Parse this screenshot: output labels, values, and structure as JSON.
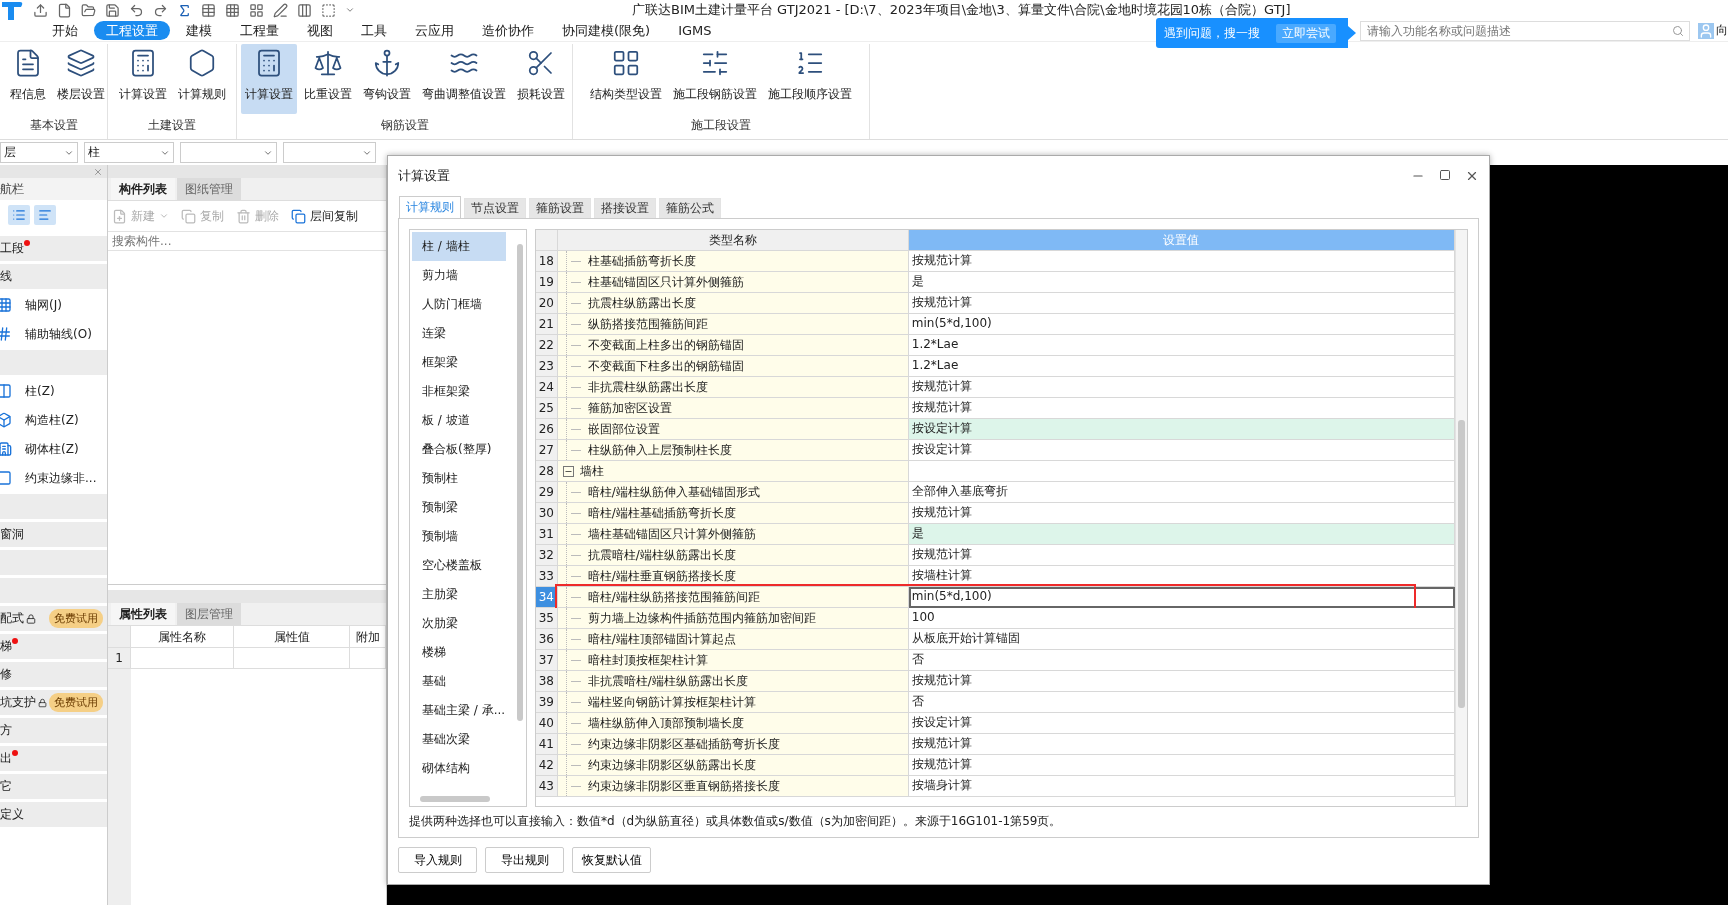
{
  "window": {
    "title": "广联达BIM土建计量平台 GTJ2021 - [D:\\7、2023年项目\\金地\\3、算量文件\\合院\\金地时境花园10栋（合院）GTJ]"
  },
  "menu": [
    {
      "label": "开始",
      "selected": false
    },
    {
      "label": "工程设置",
      "selected": true
    },
    {
      "label": "建模",
      "selected": false
    },
    {
      "label": "工程量",
      "selected": false
    },
    {
      "label": "视图",
      "selected": false
    },
    {
      "label": "工具",
      "selected": false
    },
    {
      "label": "云应用",
      "selected": false
    },
    {
      "label": "造价协作",
      "selected": false
    },
    {
      "label": "协同建模(限免)",
      "selected": false
    },
    {
      "label": "IGMS",
      "selected": false
    }
  ],
  "help_popup": {
    "text": "遇到问题，搜一搜",
    "button": "立即尝试"
  },
  "help_search": {
    "placeholder": "请输入功能名称或问题描述"
  },
  "user": {
    "name": "向"
  },
  "ribbon": [
    {
      "label": "基本设置",
      "buttons": [
        {
          "label": "程信息",
          "selected": false
        },
        {
          "label": "楼层设置",
          "selected": false
        }
      ]
    },
    {
      "label": "土建设置",
      "buttons": [
        {
          "label": "计算设置",
          "selected": false
        },
        {
          "label": "计算规则",
          "selected": false
        }
      ]
    },
    {
      "label": "钢筋设置",
      "buttons": [
        {
          "label": "计算设置",
          "selected": true
        },
        {
          "label": "比重设置",
          "selected": false
        },
        {
          "label": "弯钩设置",
          "selected": false
        },
        {
          "label": "弯曲调整值设置",
          "selected": false
        },
        {
          "label": "损耗设置",
          "selected": false
        }
      ]
    },
    {
      "label": "施工段设置",
      "buttons": [
        {
          "label": "结构类型设置",
          "selected": false
        },
        {
          "label": "施工段钢筋设置",
          "selected": false
        },
        {
          "label": "施工段顺序设置",
          "selected": false
        }
      ]
    }
  ],
  "dropdowns": [
    {
      "value": "层"
    },
    {
      "value": "柱"
    }
  ],
  "nav": {
    "title": "航栏",
    "items": [
      {
        "kind": "group",
        "label": "工段",
        "dot": true,
        "locked": false
      },
      {
        "kind": "group",
        "label": "线",
        "dot": false,
        "locked": false
      },
      {
        "kind": "item",
        "label": "轴网(J)",
        "dot": false,
        "locked": false
      },
      {
        "kind": "item",
        "label": "辅助轴线(O)",
        "dot": false,
        "locked": false
      },
      {
        "kind": "group",
        "dot": false,
        "locked": false
      },
      {
        "kind": "item",
        "label": "柱(Z)",
        "dot": false,
        "locked": false
      },
      {
        "kind": "item",
        "label": "构造柱(Z)",
        "dot": false,
        "locked": false
      },
      {
        "kind": "item",
        "label": "砌体柱(Z)",
        "dot": false,
        "locked": false
      },
      {
        "kind": "item",
        "label": "约束边缘非...",
        "dot": false,
        "locked": false
      },
      {
        "kind": "group",
        "dot": false,
        "locked": false
      },
      {
        "kind": "group",
        "label": "窗洞",
        "dot": false,
        "locked": false
      },
      {
        "kind": "group",
        "dot": false,
        "locked": false
      },
      {
        "kind": "group",
        "dot": false,
        "locked": false
      },
      {
        "kind": "group",
        "label": "配式",
        "dot": false,
        "locked": true,
        "badge": "免费试用"
      },
      {
        "kind": "group",
        "label": "梯",
        "dot": true,
        "locked": false
      },
      {
        "kind": "group",
        "label": "修",
        "dot": false,
        "locked": false
      },
      {
        "kind": "group",
        "label": "坑支护",
        "dot": false,
        "locked": true,
        "badge": "免费试用"
      },
      {
        "kind": "group",
        "label": "方",
        "dot": false,
        "locked": false
      },
      {
        "kind": "group",
        "label": "出",
        "dot": true,
        "locked": false
      },
      {
        "kind": "group",
        "label": "它",
        "dot": false,
        "locked": false
      },
      {
        "kind": "group",
        "label": "定义",
        "dot": false,
        "locked": false
      }
    ]
  },
  "component_panel": {
    "tabs": [
      {
        "label": "构件列表",
        "selected": true
      },
      {
        "label": "图纸管理",
        "selected": false
      }
    ],
    "toolbar": [
      {
        "kind": "dropdown",
        "label": "新建",
        "disabled": true
      },
      {
        "kind": "button",
        "label": "复制",
        "disabled": true
      },
      {
        "kind": "button",
        "label": "删除",
        "disabled": true
      },
      {
        "kind": "button",
        "label": "层间复制",
        "disabled": false
      }
    ],
    "search": {
      "placeholder": "搜索构件..."
    }
  },
  "property_panel": {
    "tabs": [
      {
        "label": "属性列表",
        "selected": true
      },
      {
        "label": "图层管理",
        "selected": false
      }
    ],
    "columns": [
      "属性名称",
      "属性值",
      "附加"
    ],
    "rows": [
      {
        "number": "1"
      }
    ]
  },
  "dialog": {
    "title": "计算设置",
    "tabs": [
      {
        "label": "计算规则",
        "selected": true
      },
      {
        "label": "节点设置",
        "selected": false
      },
      {
        "label": "箍筋设置",
        "selected": false
      },
      {
        "label": "搭接设置",
        "selected": false
      },
      {
        "label": "箍筋公式",
        "selected": false
      }
    ],
    "categories": [
      {
        "label": "柱 / 墙柱",
        "selected": true
      },
      {
        "label": "剪力墙",
        "selected": false
      },
      {
        "label": "人防门框墙",
        "selected": false
      },
      {
        "label": "连梁",
        "selected": false
      },
      {
        "label": "框架梁",
        "selected": false
      },
      {
        "label": "非框架梁",
        "selected": false
      },
      {
        "label": "板 / 坡道",
        "selected": false
      },
      {
        "label": "叠合板(整厚)",
        "selected": false
      },
      {
        "label": "预制柱",
        "selected": false
      },
      {
        "label": "预制梁",
        "selected": false
      },
      {
        "label": "预制墙",
        "selected": false
      },
      {
        "label": "空心楼盖板",
        "selected": false
      },
      {
        "label": "主肋梁",
        "selected": false
      },
      {
        "label": "次肋梁",
        "selected": false
      },
      {
        "label": "楼梯",
        "selected": false
      },
      {
        "label": "基础",
        "selected": false
      },
      {
        "label": "基础主梁 / 承...",
        "selected": false
      },
      {
        "label": "基础次梁",
        "selected": false
      },
      {
        "label": "砌体结构",
        "selected": false
      }
    ],
    "table": {
      "columns": [
        "类型名称",
        "设置值"
      ],
      "rows": [
        {
          "kind": "item",
          "number": "18",
          "name": "柱基础插筋弯折长度",
          "value": "按规范计算",
          "selected": false,
          "highlight": false,
          "marked": false
        },
        {
          "kind": "item",
          "number": "19",
          "name": "柱基础锚固区只计算外侧箍筋",
          "value": "是",
          "selected": false,
          "highlight": false,
          "marked": false
        },
        {
          "kind": "item",
          "number": "20",
          "name": "抗震柱纵筋露出长度",
          "value": "按规范计算",
          "selected": false,
          "highlight": false,
          "marked": false
        },
        {
          "kind": "item",
          "number": "21",
          "name": "纵筋搭接范围箍筋间距",
          "value": "min(5*d,100)",
          "selected": false,
          "highlight": false,
          "marked": false
        },
        {
          "kind": "item",
          "number": "22",
          "name": "不变截面上柱多出的钢筋锚固",
          "value": "1.2*Lae",
          "selected": false,
          "highlight": false,
          "marked": false
        },
        {
          "kind": "item",
          "number": "23",
          "name": "不变截面下柱多出的钢筋锚固",
          "value": "1.2*Lae",
          "selected": false,
          "highlight": false,
          "marked": false
        },
        {
          "kind": "item",
          "number": "24",
          "name": "非抗震柱纵筋露出长度",
          "value": "按规范计算",
          "selected": false,
          "highlight": false,
          "marked": false
        },
        {
          "kind": "item",
          "number": "25",
          "name": "箍筋加密区设置",
          "value": "按规范计算",
          "selected": false,
          "highlight": false,
          "marked": false
        },
        {
          "kind": "item",
          "number": "26",
          "name": "嵌固部位设置",
          "value": "按设定计算",
          "selected": false,
          "highlight": true,
          "marked": false
        },
        {
          "kind": "item",
          "number": "27",
          "name": "柱纵筋伸入上层预制柱长度",
          "value": "按设定计算",
          "selected": false,
          "highlight": false,
          "marked": false
        },
        {
          "kind": "group",
          "number": "28",
          "name": "墙柱",
          "expanded": true,
          "selected": false,
          "highlight": false,
          "marked": false
        },
        {
          "kind": "item",
          "number": "29",
          "name": "暗柱/端柱纵筋伸入基础锚固形式",
          "value": "全部伸入基底弯折",
          "selected": false,
          "highlight": false,
          "marked": false
        },
        {
          "kind": "item",
          "number": "30",
          "name": "暗柱/端柱基础插筋弯折长度",
          "value": "按规范计算",
          "selected": false,
          "highlight": false,
          "marked": false
        },
        {
          "kind": "item",
          "number": "31",
          "name": "墙柱基础锚固区只计算外侧箍筋",
          "value": "是",
          "selected": false,
          "highlight": true,
          "marked": false
        },
        {
          "kind": "item",
          "number": "32",
          "name": "抗震暗柱/端柱纵筋露出长度",
          "value": "按规范计算",
          "selected": false,
          "highlight": false,
          "marked": false
        },
        {
          "kind": "item",
          "number": "33",
          "name": "暗柱/端柱垂直钢筋搭接长度",
          "value": "按墙柱计算",
          "selected": false,
          "highlight": false,
          "marked": false
        },
        {
          "kind": "item",
          "number": "34",
          "name": "暗柱/端柱纵筋搭接范围箍筋间距",
          "value": "min(5*d,100)",
          "selected": true,
          "highlight": false,
          "marked": true
        },
        {
          "kind": "item",
          "number": "35",
          "name": "剪力墙上边缘构件插筋范围内箍筋加密间距",
          "value": "100",
          "selected": false,
          "highlight": false,
          "marked": false
        },
        {
          "kind": "item",
          "number": "36",
          "name": "暗柱/端柱顶部锚固计算起点",
          "value": "从板底开始计算锚固",
          "selected": false,
          "highlight": false,
          "marked": false
        },
        {
          "kind": "item",
          "number": "37",
          "name": "暗柱封顶按框架柱计算",
          "value": "否",
          "selected": false,
          "highlight": false,
          "marked": false
        },
        {
          "kind": "item",
          "number": "38",
          "name": "非抗震暗柱/端柱纵筋露出长度",
          "value": "按规范计算",
          "selected": false,
          "highlight": false,
          "marked": false
        },
        {
          "kind": "item",
          "number": "39",
          "name": "端柱竖向钢筋计算按框架柱计算",
          "value": "否",
          "selected": false,
          "highlight": false,
          "marked": false
        },
        {
          "kind": "item",
          "number": "40",
          "name": "墙柱纵筋伸入顶部预制墙长度",
          "value": "按设定计算",
          "selected": false,
          "highlight": false,
          "marked": false
        },
        {
          "kind": "item",
          "number": "41",
          "name": "约束边缘非阴影区基础插筋弯折长度",
          "value": "按规范计算",
          "selected": false,
          "highlight": false,
          "marked": false
        },
        {
          "kind": "item",
          "number": "42",
          "name": "约束边缘非阴影区纵筋露出长度",
          "value": "按规范计算",
          "selected": false,
          "highlight": false,
          "marked": false
        },
        {
          "kind": "item",
          "number": "43",
          "name": "约束边缘非阴影区垂直钢筋搭接长度",
          "value": "按墙身计算",
          "selected": false,
          "highlight": false,
          "marked": false
        }
      ]
    },
    "note": "提供两种选择也可以直接输入：数值*d（d为纵筋直径）或具体数值或s/数值（s为加密间距）。来源于16G101-1第59页。",
    "buttons": [
      "导入规则",
      "导出规则",
      "恢复默认值"
    ]
  }
}
